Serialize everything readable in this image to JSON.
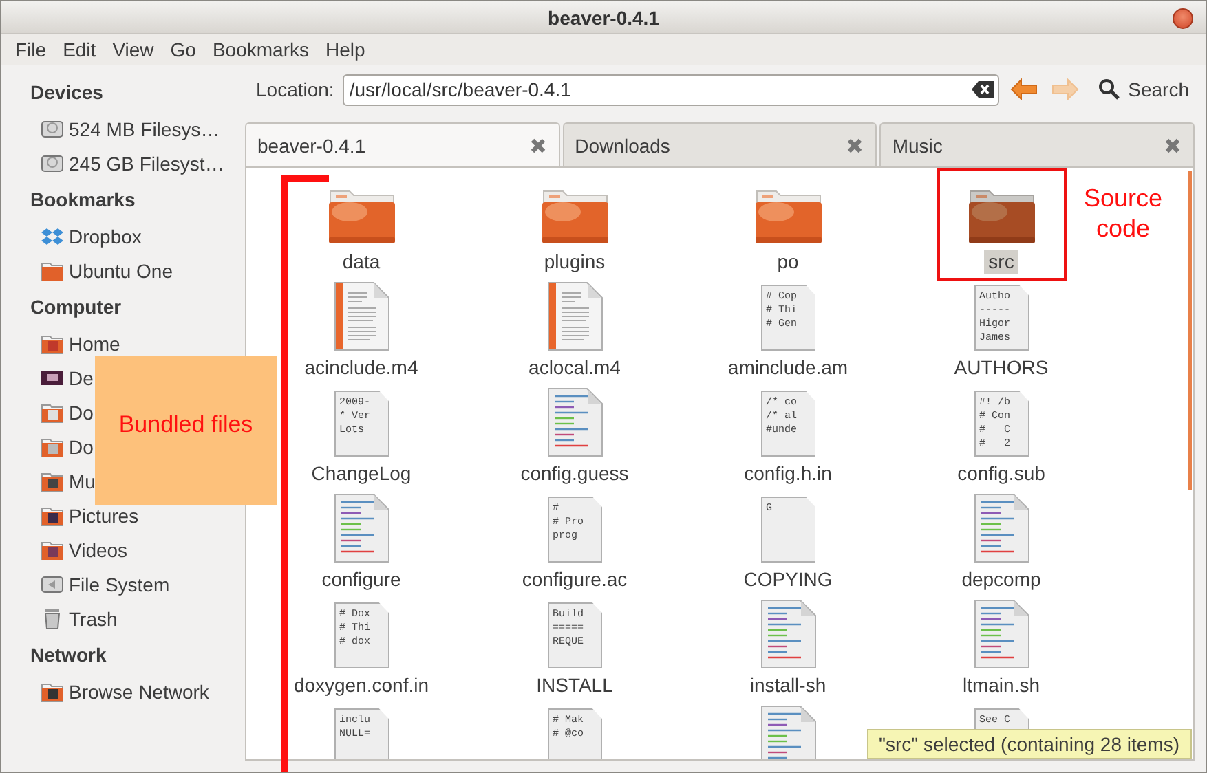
{
  "window": {
    "title": "beaver-0.4.1"
  },
  "menu": [
    "File",
    "Edit",
    "View",
    "Go",
    "Bookmarks",
    "Help"
  ],
  "sidebar": [
    {
      "heading": "Devices",
      "items": [
        {
          "label": "524 MB Filesys…",
          "kind": "drive"
        },
        {
          "label": "245 GB Filesyst…",
          "kind": "drive"
        }
      ]
    },
    {
      "heading": "Bookmarks",
      "items": [
        {
          "label": "Dropbox",
          "kind": "dropbox"
        },
        {
          "label": "Ubuntu One",
          "kind": "folder"
        }
      ]
    },
    {
      "heading": "Computer",
      "items": [
        {
          "label": "Home",
          "kind": "home"
        },
        {
          "label": "De",
          "kind": "desktop"
        },
        {
          "label": "Do",
          "kind": "documents"
        },
        {
          "label": "Do",
          "kind": "downloads"
        },
        {
          "label": "Mu",
          "kind": "music"
        },
        {
          "label": "Pictures",
          "kind": "pictures"
        },
        {
          "label": "Videos",
          "kind": "videos"
        },
        {
          "label": "File System",
          "kind": "filesystem"
        },
        {
          "label": "Trash",
          "kind": "trash"
        }
      ]
    },
    {
      "heading": "Network",
      "items": [
        {
          "label": "Browse Network",
          "kind": "network"
        }
      ]
    }
  ],
  "location": {
    "label": "Location:",
    "value": "/usr/local/src/beaver-0.4.1"
  },
  "nav": [
    {
      "kind": "back",
      "disabled": false
    },
    {
      "kind": "forward",
      "disabled": true
    }
  ],
  "search": {
    "label": "Search"
  },
  "tabs": [
    {
      "label": "beaver-0.4.1",
      "selected": true
    },
    {
      "label": "Downloads",
      "selected": false
    },
    {
      "label": "Music",
      "selected": false
    }
  ],
  "files": [
    {
      "name": "data",
      "kind": "folder",
      "selected": false
    },
    {
      "name": "plugins",
      "kind": "folder",
      "selected": false
    },
    {
      "name": "po",
      "kind": "folder",
      "selected": false
    },
    {
      "name": "src",
      "kind": "folder",
      "selected": true
    },
    {
      "name": "acinclude.m4",
      "kind": "document",
      "selected": false
    },
    {
      "name": "aclocal.m4",
      "kind": "document",
      "selected": false
    },
    {
      "name": "aminclude.am",
      "kind": "preview",
      "selected": false,
      "preview": [
        "# Cop",
        "# Thi",
        "# Gen"
      ]
    },
    {
      "name": "AUTHORS",
      "kind": "preview",
      "selected": false,
      "preview": [
        "Autho",
        "-----",
        "Higor",
        "James"
      ]
    },
    {
      "name": "ChangeLog",
      "kind": "preview",
      "selected": false,
      "preview": [
        "2009-",
        "* Ver",
        "Lots"
      ]
    },
    {
      "name": "config.guess",
      "kind": "script",
      "selected": false
    },
    {
      "name": "config.h.in",
      "kind": "preview",
      "selected": false,
      "preview": [
        "/* co",
        "/* al",
        "#unde"
      ]
    },
    {
      "name": "config.sub",
      "kind": "preview",
      "selected": false,
      "preview": [
        "#! /b",
        "# Con",
        "#   C",
        "#   2"
      ]
    },
    {
      "name": "configure",
      "kind": "script",
      "selected": false
    },
    {
      "name": "configure.ac",
      "kind": "preview",
      "selected": false,
      "preview": [
        "#",
        "# Pro",
        "prog"
      ]
    },
    {
      "name": "COPYING",
      "kind": "preview",
      "selected": false,
      "preview": [
        "G"
      ]
    },
    {
      "name": "depcomp",
      "kind": "script",
      "selected": false
    },
    {
      "name": "doxygen.conf.in",
      "kind": "preview",
      "selected": false,
      "preview": [
        "# Dox",
        "# Thi",
        "# dox"
      ]
    },
    {
      "name": "INSTALL",
      "kind": "preview",
      "selected": false,
      "preview": [
        "Build",
        "=====",
        "REQUE"
      ]
    },
    {
      "name": "install-sh",
      "kind": "script",
      "selected": false
    },
    {
      "name": "ltmain.sh",
      "kind": "script",
      "selected": false
    },
    {
      "kind": "preview",
      "selected": false,
      "preview": [
        "inclu",
        "NULL="
      ]
    },
    {
      "kind": "preview",
      "selected": false,
      "preview": [
        "# Mak",
        "# @co"
      ]
    },
    {
      "kind": "script",
      "selected": false
    },
    {
      "kind": "preview",
      "selected": false,
      "preview": [
        "See C"
      ]
    }
  ],
  "status": "\"src\" selected (containing 28 items)",
  "annotations": [
    {
      "kind": "bracket"
    },
    {
      "kind": "frame"
    },
    {
      "kind": "note",
      "text": "Source code"
    },
    {
      "kind": "box",
      "text": "Bundled files"
    }
  ]
}
